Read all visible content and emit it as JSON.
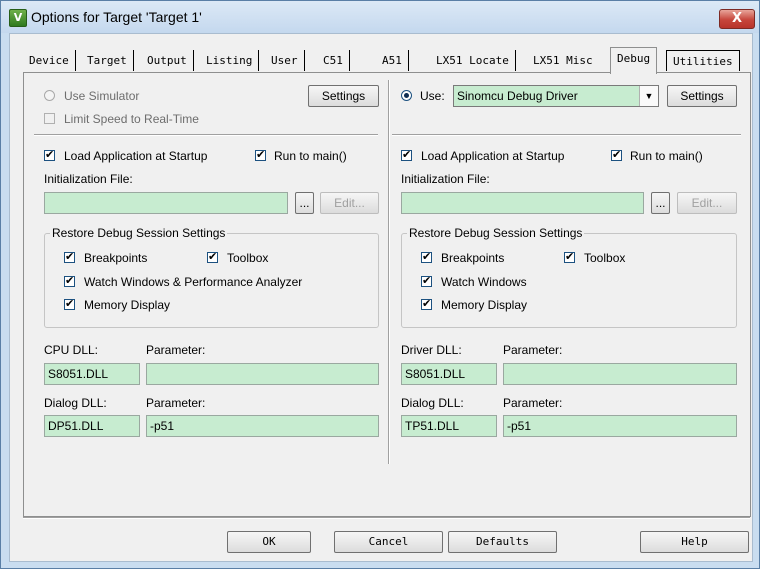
{
  "window": {
    "title": "Options for Target 'Target 1'",
    "icon": "keil-uvision-icon",
    "close_label": "X"
  },
  "tabs": [
    {
      "label": "Device"
    },
    {
      "label": "Target"
    },
    {
      "label": "Output"
    },
    {
      "label": "Listing"
    },
    {
      "label": "User"
    },
    {
      "label": "C51"
    },
    {
      "label": "A51"
    },
    {
      "label": "LX51 Locate"
    },
    {
      "label": "LX51 Misc"
    },
    {
      "label": "Debug",
      "active": true
    },
    {
      "label": "Utilities"
    }
  ],
  "left": {
    "use_simulator": "Use Simulator",
    "limit_speed": "Limit Speed to Real-Time",
    "settings_label": "Settings",
    "load_app": "Load Application at Startup",
    "run_to_main": "Run to main()",
    "init_file_label": "Initialization File:",
    "init_file_value": "",
    "browse_label": "...",
    "edit_label": "Edit...",
    "restore_group": "Restore Debug Session Settings",
    "breakpoints": "Breakpoints",
    "toolbox": "Toolbox",
    "watch": "Watch Windows & Performance Analyzer",
    "memory": "Memory Display",
    "cpu_dll_label": "CPU DLL:",
    "cpu_dll_value": "S8051.DLL",
    "param_label": "Parameter:",
    "cpu_param_value": "",
    "dialog_dll_label": "Dialog DLL:",
    "dialog_dll_value": "DP51.DLL",
    "dialog_param_label": "Parameter:",
    "dialog_param_value": "-p51"
  },
  "right": {
    "use_label": "Use:",
    "driver_select": "Sinomcu Debug Driver",
    "settings_label": "Settings",
    "load_app": "Load Application at Startup",
    "run_to_main": "Run to main()",
    "init_file_label": "Initialization File:",
    "init_file_value": "",
    "browse_label": "...",
    "edit_label": "Edit...",
    "restore_group": "Restore Debug Session Settings",
    "breakpoints": "Breakpoints",
    "toolbox": "Toolbox",
    "watch": "Watch Windows",
    "memory": "Memory Display",
    "driver_dll_label": "Driver DLL:",
    "driver_dll_value": "S8051.DLL",
    "param_label": "Parameter:",
    "driver_param_value": "",
    "dialog_dll_label": "Dialog DLL:",
    "dialog_dll_value": "TP51.DLL",
    "dialog_param_label": "Parameter:",
    "dialog_param_value": "-p51"
  },
  "footer": {
    "ok": "OK",
    "cancel": "Cancel",
    "defaults": "Defaults",
    "help": "Help"
  },
  "colors": {
    "field_bg": "#c7ecd0",
    "title_bg": "#c9ddf0",
    "close_bg": "#c6453b"
  }
}
